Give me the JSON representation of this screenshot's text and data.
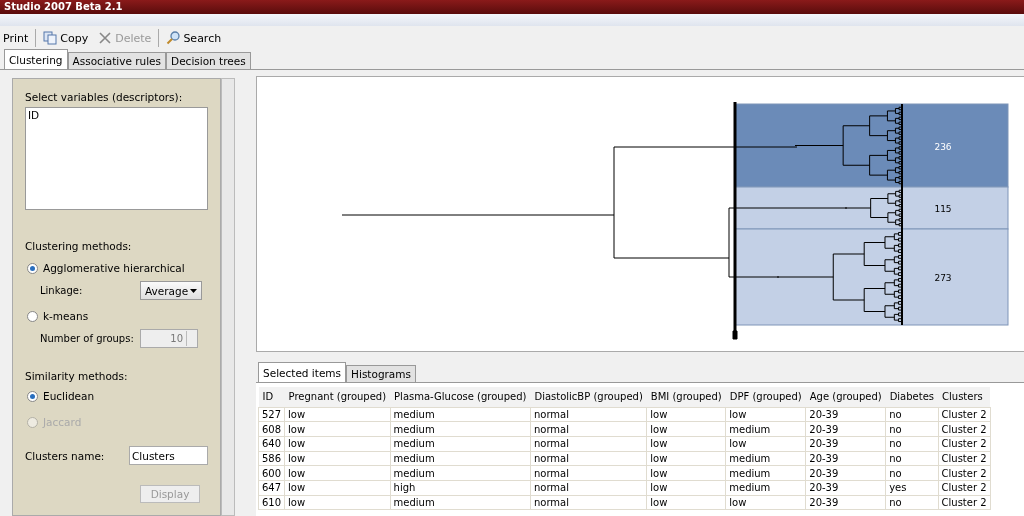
{
  "window": {
    "title": "Studio 2007 Beta 2.1"
  },
  "toolbar": [
    {
      "label": "Print",
      "kind": "plain",
      "disabled": false
    },
    {
      "label": "Copy",
      "kind": "copy",
      "disabled": false
    },
    {
      "label": "Delete",
      "kind": "delete",
      "disabled": true
    },
    {
      "label": "Search",
      "kind": "search",
      "disabled": false
    }
  ],
  "tabs": [
    {
      "label": "Clustering",
      "selected": true
    },
    {
      "label": "Associative rules",
      "selected": false
    },
    {
      "label": "Decision trees",
      "selected": false
    }
  ],
  "settings": {
    "variables_label": "Select variables (descriptors):",
    "variables": [
      "ID"
    ],
    "methods_label": "Clustering methods:",
    "methods": [
      {
        "label": "Agglomerative hierarchical",
        "selected": true,
        "disabled": false,
        "option": {
          "kind": "dropdown",
          "label": "Linkage:",
          "value": "Average",
          "disabled": false
        }
      },
      {
        "label": "k-means",
        "selected": false,
        "disabled": false,
        "option": {
          "kind": "spinner",
          "label": "Number of groups:",
          "value": "10",
          "disabled": true
        }
      }
    ],
    "similarity_label": "Similarity methods:",
    "similarity": [
      {
        "label": "Euclidean",
        "selected": true,
        "disabled": false
      },
      {
        "label": "Jaccard",
        "selected": false,
        "disabled": true
      }
    ],
    "name_label": "Clusters name:",
    "name_value": "Clusters",
    "display_button": {
      "label": "Display",
      "disabled": true
    }
  },
  "dendrogram": {
    "clusters": [
      {
        "count": "236",
        "selected": true
      },
      {
        "count": "115",
        "selected": false
      },
      {
        "count": "273",
        "selected": false
      }
    ]
  },
  "bottom_tabs": [
    {
      "label": "Selected items",
      "selected": true
    },
    {
      "label": "Histograms",
      "selected": false
    }
  ],
  "table": {
    "columns": [
      "ID",
      "Pregnant (grouped)",
      "Plasma-Glucose (grouped)",
      "DiastolicBP (grouped)",
      "BMI (grouped)",
      "DPF (grouped)",
      "Age (grouped)",
      "Diabetes",
      "Clusters"
    ],
    "rows": [
      [
        "527",
        "low",
        "medium",
        "normal",
        "low",
        "low",
        "20-39",
        "no",
        "Cluster 2"
      ],
      [
        "608",
        "low",
        "medium",
        "normal",
        "low",
        "medium",
        "20-39",
        "no",
        "Cluster 2"
      ],
      [
        "640",
        "low",
        "medium",
        "normal",
        "low",
        "low",
        "20-39",
        "no",
        "Cluster 2"
      ],
      [
        "586",
        "low",
        "medium",
        "normal",
        "low",
        "medium",
        "20-39",
        "no",
        "Cluster 2"
      ],
      [
        "600",
        "low",
        "medium",
        "normal",
        "low",
        "medium",
        "20-39",
        "no",
        "Cluster 2"
      ],
      [
        "647",
        "low",
        "high",
        "normal",
        "low",
        "medium",
        "20-39",
        "yes",
        "Cluster 2"
      ],
      [
        "610",
        "low",
        "medium",
        "normal",
        "low",
        "low",
        "20-39",
        "no",
        "Cluster 2"
      ]
    ]
  }
}
